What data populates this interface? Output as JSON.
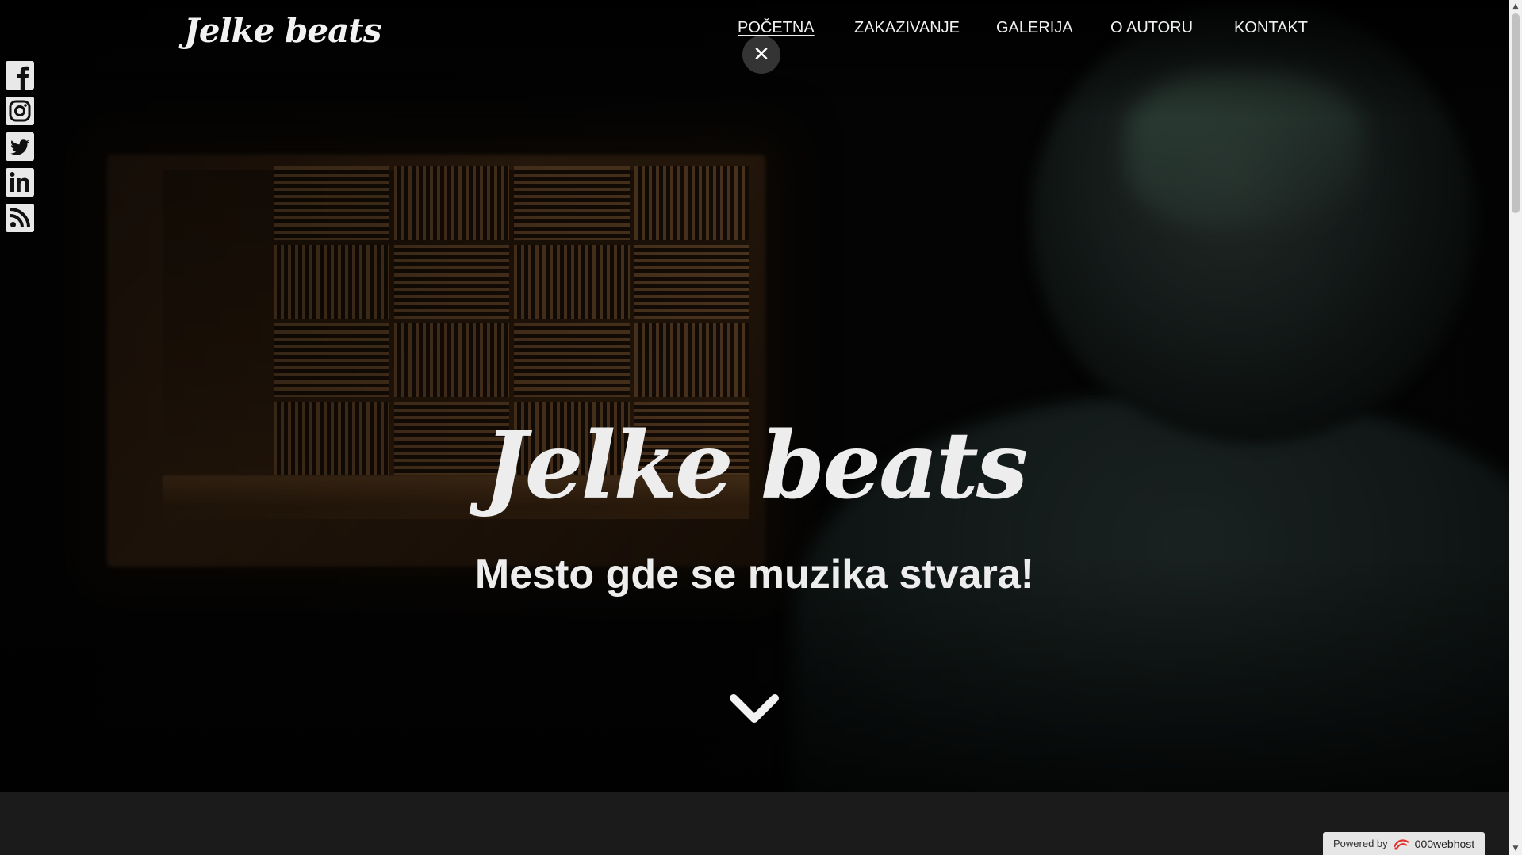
{
  "header": {
    "logo": "Jelke beats",
    "nav": [
      {
        "label": "POČETNA",
        "active": true
      },
      {
        "label": "ZAKAZIVANJE",
        "active": false
      },
      {
        "label": "GALERIJA",
        "active": false
      },
      {
        "label": "O AUTORU",
        "active": false
      },
      {
        "label": "KONTAKT",
        "active": false
      }
    ],
    "close_symbol": "✕"
  },
  "social": [
    {
      "name": "facebook-icon"
    },
    {
      "name": "instagram-icon"
    },
    {
      "name": "twitter-icon"
    },
    {
      "name": "linkedin-icon"
    },
    {
      "name": "rss-icon"
    }
  ],
  "hero": {
    "title": "Jelke beats",
    "subtitle": "Mesto gde se muzika stvara!",
    "scroll_icon": "chevron-down-icon"
  },
  "footer_badge": {
    "powered_label": "Powered by",
    "brand": "000webhost"
  },
  "colors": {
    "text": "#ededed",
    "background": "#050505",
    "section_below": "#1b1b1b",
    "badge_bg": "#e6e6e6"
  }
}
